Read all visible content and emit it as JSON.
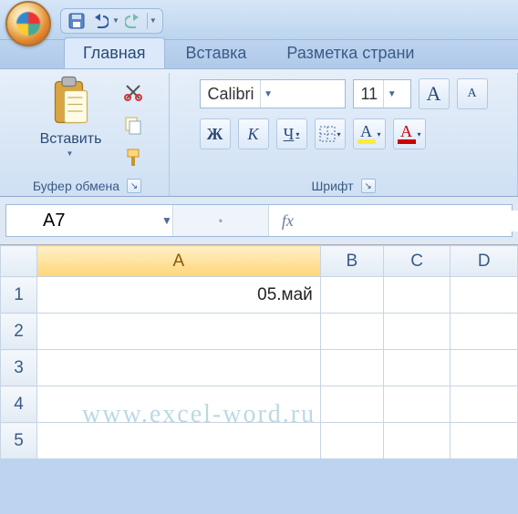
{
  "qat": {
    "save": "save",
    "undo": "undo",
    "redo": "redo"
  },
  "tabs": {
    "home": "Главная",
    "insert": "Вставка",
    "layout": "Разметка страни"
  },
  "clipboard": {
    "paste": "Вставить",
    "group": "Буфер обмена"
  },
  "font": {
    "group": "Шрифт",
    "name": "Calibri",
    "size": "11",
    "bold": "Ж",
    "italic": "К",
    "underline": "Ч",
    "growA": "A",
    "shrinkA": "A",
    "fillA": "A",
    "fontColorA": "A"
  },
  "formula_bar": {
    "namebox": "A7",
    "fx": "fx",
    "value": ""
  },
  "grid": {
    "cols": [
      "A",
      "B",
      "C",
      "D"
    ],
    "rows": [
      "1",
      "2",
      "3",
      "4",
      "5"
    ],
    "active_col": "A",
    "cells": {
      "A1": "05.май"
    }
  },
  "watermark": "www.excel-word.ru"
}
